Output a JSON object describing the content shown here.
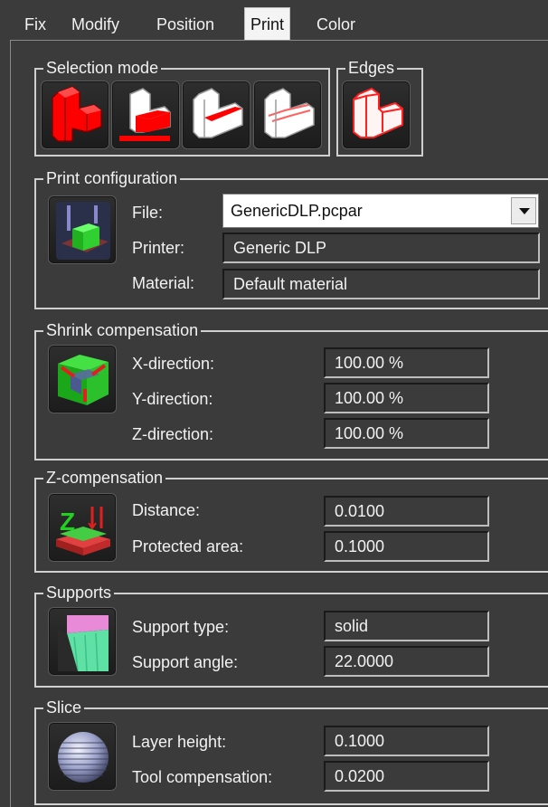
{
  "tabs": {
    "fix": "Fix",
    "modify": "Modify",
    "position": "Position",
    "print": "Print",
    "color": "Color",
    "active": "Print"
  },
  "selection_mode": {
    "title": "Selection mode",
    "buttons": [
      "select-solid-icon",
      "select-face-icon",
      "select-edge-icon",
      "select-outline-icon"
    ]
  },
  "edges": {
    "title": "Edges",
    "button": "edges-outline-icon"
  },
  "print_configuration": {
    "title": "Print configuration",
    "icon": "print-config-icon",
    "file_label": "File:",
    "file_value": "GenericDLP.pcpar",
    "printer_label": "Printer:",
    "printer_value": "Generic DLP",
    "material_label": "Material:",
    "material_value": "Default material"
  },
  "shrink_compensation": {
    "title": "Shrink compensation",
    "icon": "shrink-compensation-icon",
    "x_label": "X-direction:",
    "x_value": "100.00 %",
    "y_label": "Y-direction:",
    "y_value": "100.00 %",
    "z_label": "Z-direction:",
    "z_value": "100.00 %"
  },
  "z_compensation": {
    "title": "Z-compensation",
    "icon": "z-compensation-icon",
    "distance_label": "Distance:",
    "distance_value": "0.0100",
    "protected_label": "Protected area:",
    "protected_value": "0.1000"
  },
  "supports": {
    "title": "Supports",
    "icon": "supports-icon",
    "type_label": "Support type:",
    "type_value": "solid",
    "angle_label": "Support angle:",
    "angle_value": "22.0000"
  },
  "slice": {
    "title": "Slice",
    "icon": "slice-icon",
    "layer_label": "Layer height:",
    "layer_value": "0.1000",
    "tool_label": "Tool compensation:",
    "tool_value": "0.0200"
  },
  "colors": {
    "background": "#3b3b3b",
    "selection_red": "#ff0000",
    "shrink_green": "#22c33a",
    "support_pink": "#e88ad8",
    "support_mint": "#5fe0a4"
  }
}
